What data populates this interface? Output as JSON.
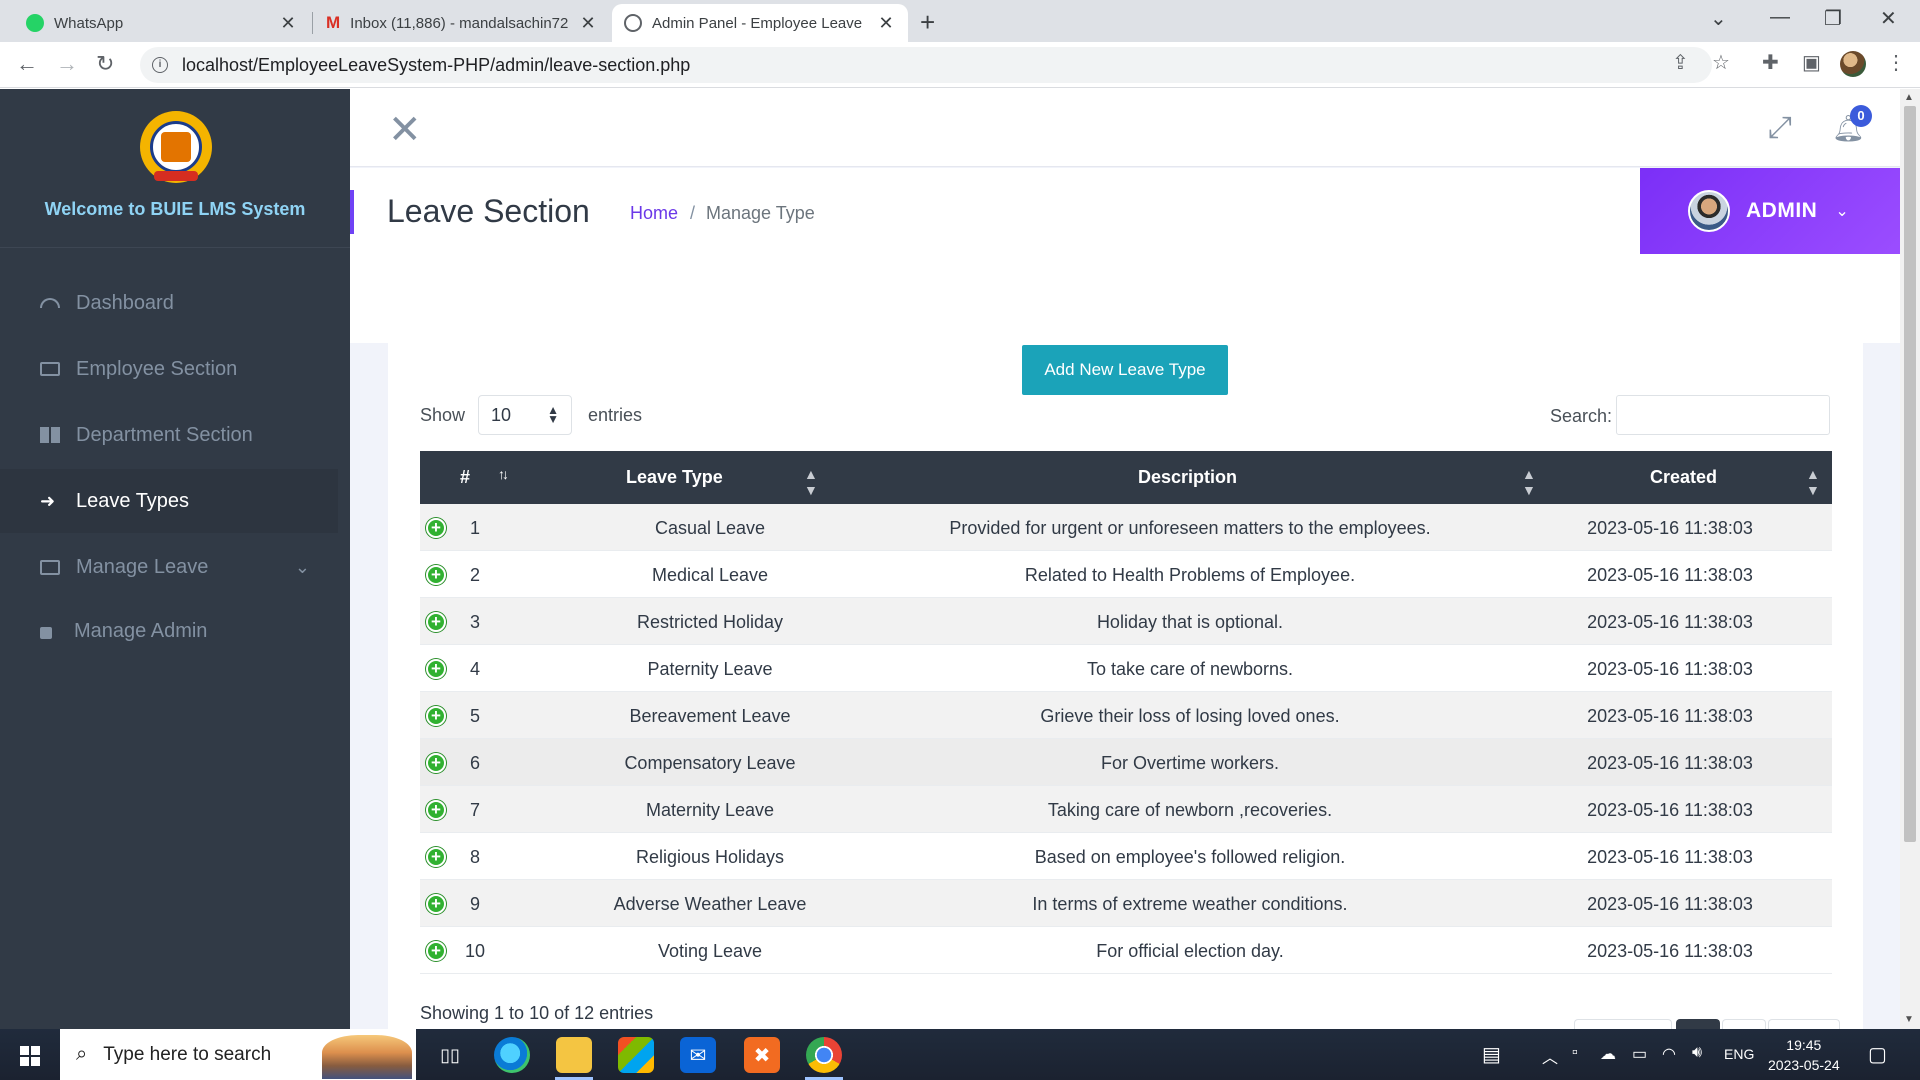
{
  "browser": {
    "tabs": [
      {
        "label": "WhatsApp",
        "icon": "whatsapp-icon"
      },
      {
        "label": "Inbox (11,886) - mandalsachin72",
        "icon": "gmail-icon"
      },
      {
        "label": "Admin Panel - Employee Leave",
        "icon": "globe-icon"
      }
    ],
    "url": "localhost/EmployeeLeaveSystem-PHP/admin/leave-section.php"
  },
  "sidebar": {
    "welcome": "Welcome to BUIE LMS System",
    "items": [
      {
        "label": "Dashboard",
        "icon": "dashboard-icon"
      },
      {
        "label": "Employee Section",
        "icon": "id-card-icon"
      },
      {
        "label": "Department Section",
        "icon": "grid-icon"
      },
      {
        "label": "Leave Types",
        "icon": "sign-out-icon"
      },
      {
        "label": "Manage Leave",
        "icon": "briefcase-icon"
      },
      {
        "label": "Manage Admin",
        "icon": "lock-icon"
      }
    ]
  },
  "header": {
    "notification_count": "0",
    "page_title": "Leave Section",
    "breadcrumb_home": "Home",
    "breadcrumb_sep": "/",
    "breadcrumb_current": "Manage Type",
    "user_label": "ADMIN"
  },
  "card": {
    "add_button": "Add New Leave Type",
    "show_label": "Show",
    "show_value": "10",
    "entries_label": "entries",
    "search_label": "Search:",
    "info": "Showing 1 to 10 of 12 entries"
  },
  "table": {
    "columns": [
      "#",
      "Leave Type",
      "Description",
      "Created"
    ],
    "rows": [
      {
        "no": "1",
        "type": "Casual Leave",
        "desc": "Provided for urgent or unforeseen matters to the employees.",
        "created": "2023-05-16 11:38:03"
      },
      {
        "no": "2",
        "type": "Medical Leave",
        "desc": "Related to Health Problems of Employee.",
        "created": "2023-05-16 11:38:03"
      },
      {
        "no": "3",
        "type": "Restricted Holiday",
        "desc": "Holiday that is optional.",
        "created": "2023-05-16 11:38:03"
      },
      {
        "no": "4",
        "type": "Paternity Leave",
        "desc": "To take care of newborns.",
        "created": "2023-05-16 11:38:03"
      },
      {
        "no": "5",
        "type": "Bereavement Leave",
        "desc": "Grieve their loss of losing loved ones.",
        "created": "2023-05-16 11:38:03"
      },
      {
        "no": "6",
        "type": "Compensatory Leave",
        "desc": "For Overtime workers.",
        "created": "2023-05-16 11:38:03"
      },
      {
        "no": "7",
        "type": "Maternity Leave",
        "desc": "Taking care of newborn ,recoveries.",
        "created": "2023-05-16 11:38:03"
      },
      {
        "no": "8",
        "type": "Religious Holidays",
        "desc": "Based on employee's followed religion.",
        "created": "2023-05-16 11:38:03"
      },
      {
        "no": "9",
        "type": "Adverse Weather Leave",
        "desc": "In terms of extreme weather conditions.",
        "created": "2023-05-16 11:38:03"
      },
      {
        "no": "10",
        "type": "Voting Leave",
        "desc": "For official election day.",
        "created": "2023-05-16 11:38:03"
      }
    ]
  },
  "taskbar": {
    "search_placeholder": "Type here to search",
    "lang": "ENG",
    "time": "19:45",
    "date": "2023-05-24"
  },
  "colors": {
    "sidebar_bg": "#313a46",
    "accent_purple": "#7b2ff7",
    "add_button": "#1ba3b9",
    "table_header": "#313a46"
  }
}
